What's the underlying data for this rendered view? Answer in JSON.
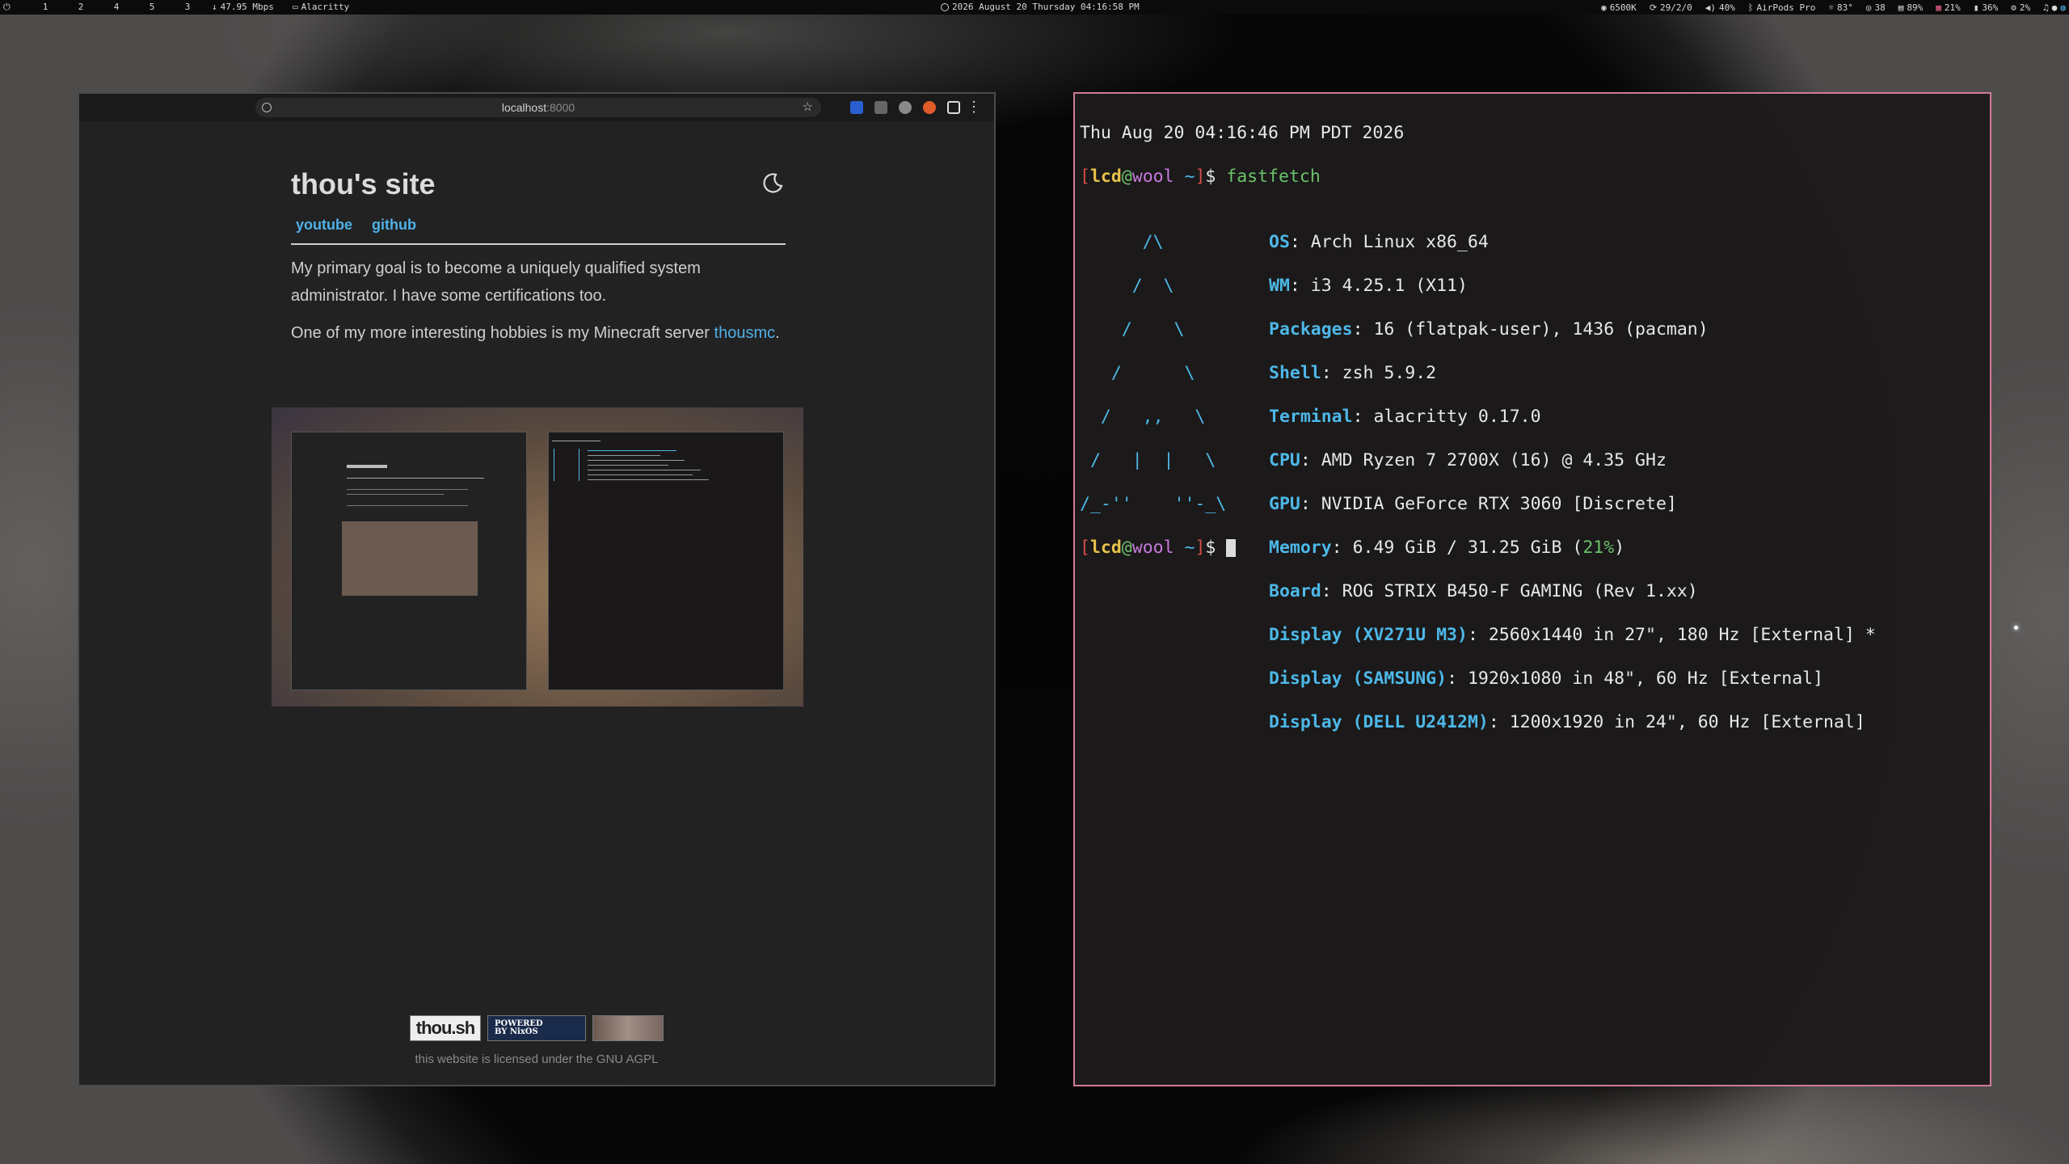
{
  "topbar": {
    "workspaces": [
      "1",
      "2",
      "4",
      "5",
      "3"
    ],
    "net_speed": "47.95 Mbps",
    "active_window": "Alacritty",
    "clock": "2026 August 20 Thursday 04:16:58 PM",
    "stats": [
      {
        "icon": "brightness-icon",
        "value": "6500K"
      },
      {
        "icon": "updates-icon",
        "value": "29/2/0"
      },
      {
        "icon": "volume-icon",
        "value": "40%"
      },
      {
        "icon": "bluetooth-icon",
        "value": "AirPods Pro"
      },
      {
        "icon": "weather-icon",
        "value": "83°"
      },
      {
        "icon": "packages-icon",
        "value": "38"
      },
      {
        "icon": "disk-icon",
        "value": "89%"
      },
      {
        "icon": "memory-icon",
        "value": "21%"
      },
      {
        "icon": "storage-icon",
        "value": "36%"
      },
      {
        "icon": "cpu-icon",
        "value": "2%"
      }
    ]
  },
  "browser": {
    "url_host": "localhost",
    "url_port": ":8000",
    "site_title": "thou's site",
    "nav": [
      "youtube",
      "github"
    ],
    "para1": "My primary goal is to become a uniquely qualified system administrator. I have some certifications too.",
    "para2_prefix": "One of my more interesting hobbies is my Minecraft server ",
    "para2_link": "thousmc",
    "para2_suffix": ".",
    "badge_thou": "thou.sh",
    "badge_nixos_1": "POWERED",
    "badge_nixos_2": "BY NixOS",
    "license": "this website is licensed under the GNU AGPL"
  },
  "terminal": {
    "date_line": "Thu Aug 20 04:16:46 PM PDT 2026",
    "prompt_user": "lcd",
    "prompt_host": "wool",
    "prompt_dir": "~",
    "command": "fastfetch",
    "logo": [
      "      /\\",
      "     /  \\",
      "    /    \\",
      "   /      \\",
      "  /   ,,   \\",
      " /   |  |   \\",
      "/_-''    ''-_\\"
    ],
    "info": [
      {
        "k": "OS",
        "v": "Arch Linux x86_64"
      },
      {
        "k": "WM",
        "v": "i3 4.25.1 (X11)"
      },
      {
        "k": "Packages",
        "v": "16 (flatpak-user), 1436 (pacman)"
      },
      {
        "k": "Shell",
        "v": "zsh 5.9.2"
      },
      {
        "k": "Terminal",
        "v": "alacritty 0.17.0"
      },
      {
        "k": "CPU",
        "v": "AMD Ryzen 7 2700X (16) @ 4.35 GHz"
      },
      {
        "k": "GPU",
        "v": "NVIDIA GeForce RTX 3060 [Discrete]"
      },
      {
        "k": "Memory",
        "v": "6.49 GiB / 31.25 GiB (",
        "extra": "21%",
        "after": ")"
      },
      {
        "k": "Board",
        "v": "ROG STRIX B450-F GAMING (Rev 1.xx)"
      },
      {
        "k": "Display (XV271U M3)",
        "v": "2560x1440 in 27\", 180 Hz [External] *"
      },
      {
        "k": "Display (SAMSUNG)",
        "v": "1920x1080 in 48\", 60 Hz [External]"
      },
      {
        "k": "Display (DELL U2412M)",
        "v": "1200x1920 in 24\", 60 Hz [External]"
      }
    ]
  },
  "colors": {
    "accent_link": "#4fb0e6",
    "terminal_border": "#d07a9a",
    "logo": "#4db8e8"
  }
}
